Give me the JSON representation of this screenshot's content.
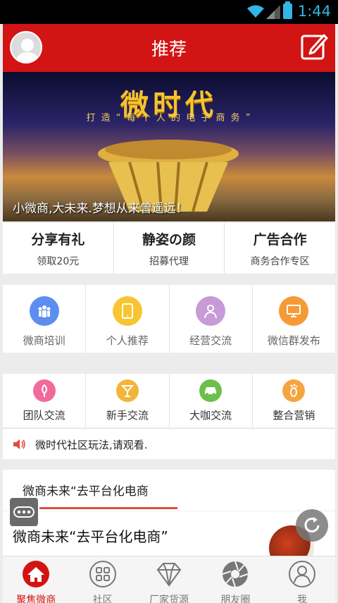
{
  "status_bar": {
    "time": "1:44"
  },
  "header": {
    "title": "推荐"
  },
  "banner": {
    "big_title": "微时代",
    "subtitle": "打 造 “ 每 个 人 的 电 子 商 务 ”",
    "caption": "小微商,大未来.梦想从来曾遥远！"
  },
  "promos": [
    {
      "title": "分享有礼",
      "sub": "领取20元"
    },
    {
      "title": "静姿の颜",
      "sub": "招募代理"
    },
    {
      "title": "广告合作",
      "sub": "商务合作专区"
    }
  ],
  "grid1": [
    {
      "label": "微商培训",
      "color": "#5b8ef0",
      "icon": "people-icon"
    },
    {
      "label": "个人推荐",
      "color": "#f7c531",
      "icon": "tablet-icon"
    },
    {
      "label": "经营交流",
      "color": "#c89ad6",
      "icon": "person-icon"
    },
    {
      "label": "微信群发布",
      "color": "#f59a35",
      "icon": "monitor-icon"
    }
  ],
  "grid2": [
    {
      "label": "团队交流",
      "color": "#f06a9a",
      "icon": "leaf-icon"
    },
    {
      "label": "新手交流",
      "color": "#f2b53a",
      "icon": "cocktail-icon"
    },
    {
      "label": "大咖交流",
      "color": "#6cc04a",
      "icon": "car-icon"
    },
    {
      "label": "整合营销",
      "color": "#f5a540",
      "icon": "footprint-icon"
    }
  ],
  "notice": {
    "text": "微时代社区玩法,请观看."
  },
  "news_tab": {
    "label": "微商未来“去平台化电商"
  },
  "news_item": {
    "title": "微商未来“去平台化电商”"
  },
  "bottom_nav": [
    {
      "label": "聚焦微商",
      "icon": "home-icon",
      "active": true
    },
    {
      "label": "社区",
      "icon": "grid-icon",
      "active": false
    },
    {
      "label": "厂家货源",
      "icon": "diamond-icon",
      "active": false
    },
    {
      "label": "朋友圈",
      "icon": "aperture-icon",
      "active": false
    },
    {
      "label": "我",
      "icon": "user-icon",
      "active": false
    }
  ],
  "colors": {
    "brand_red": "#d21414",
    "accent_blue": "#33b5e5"
  }
}
